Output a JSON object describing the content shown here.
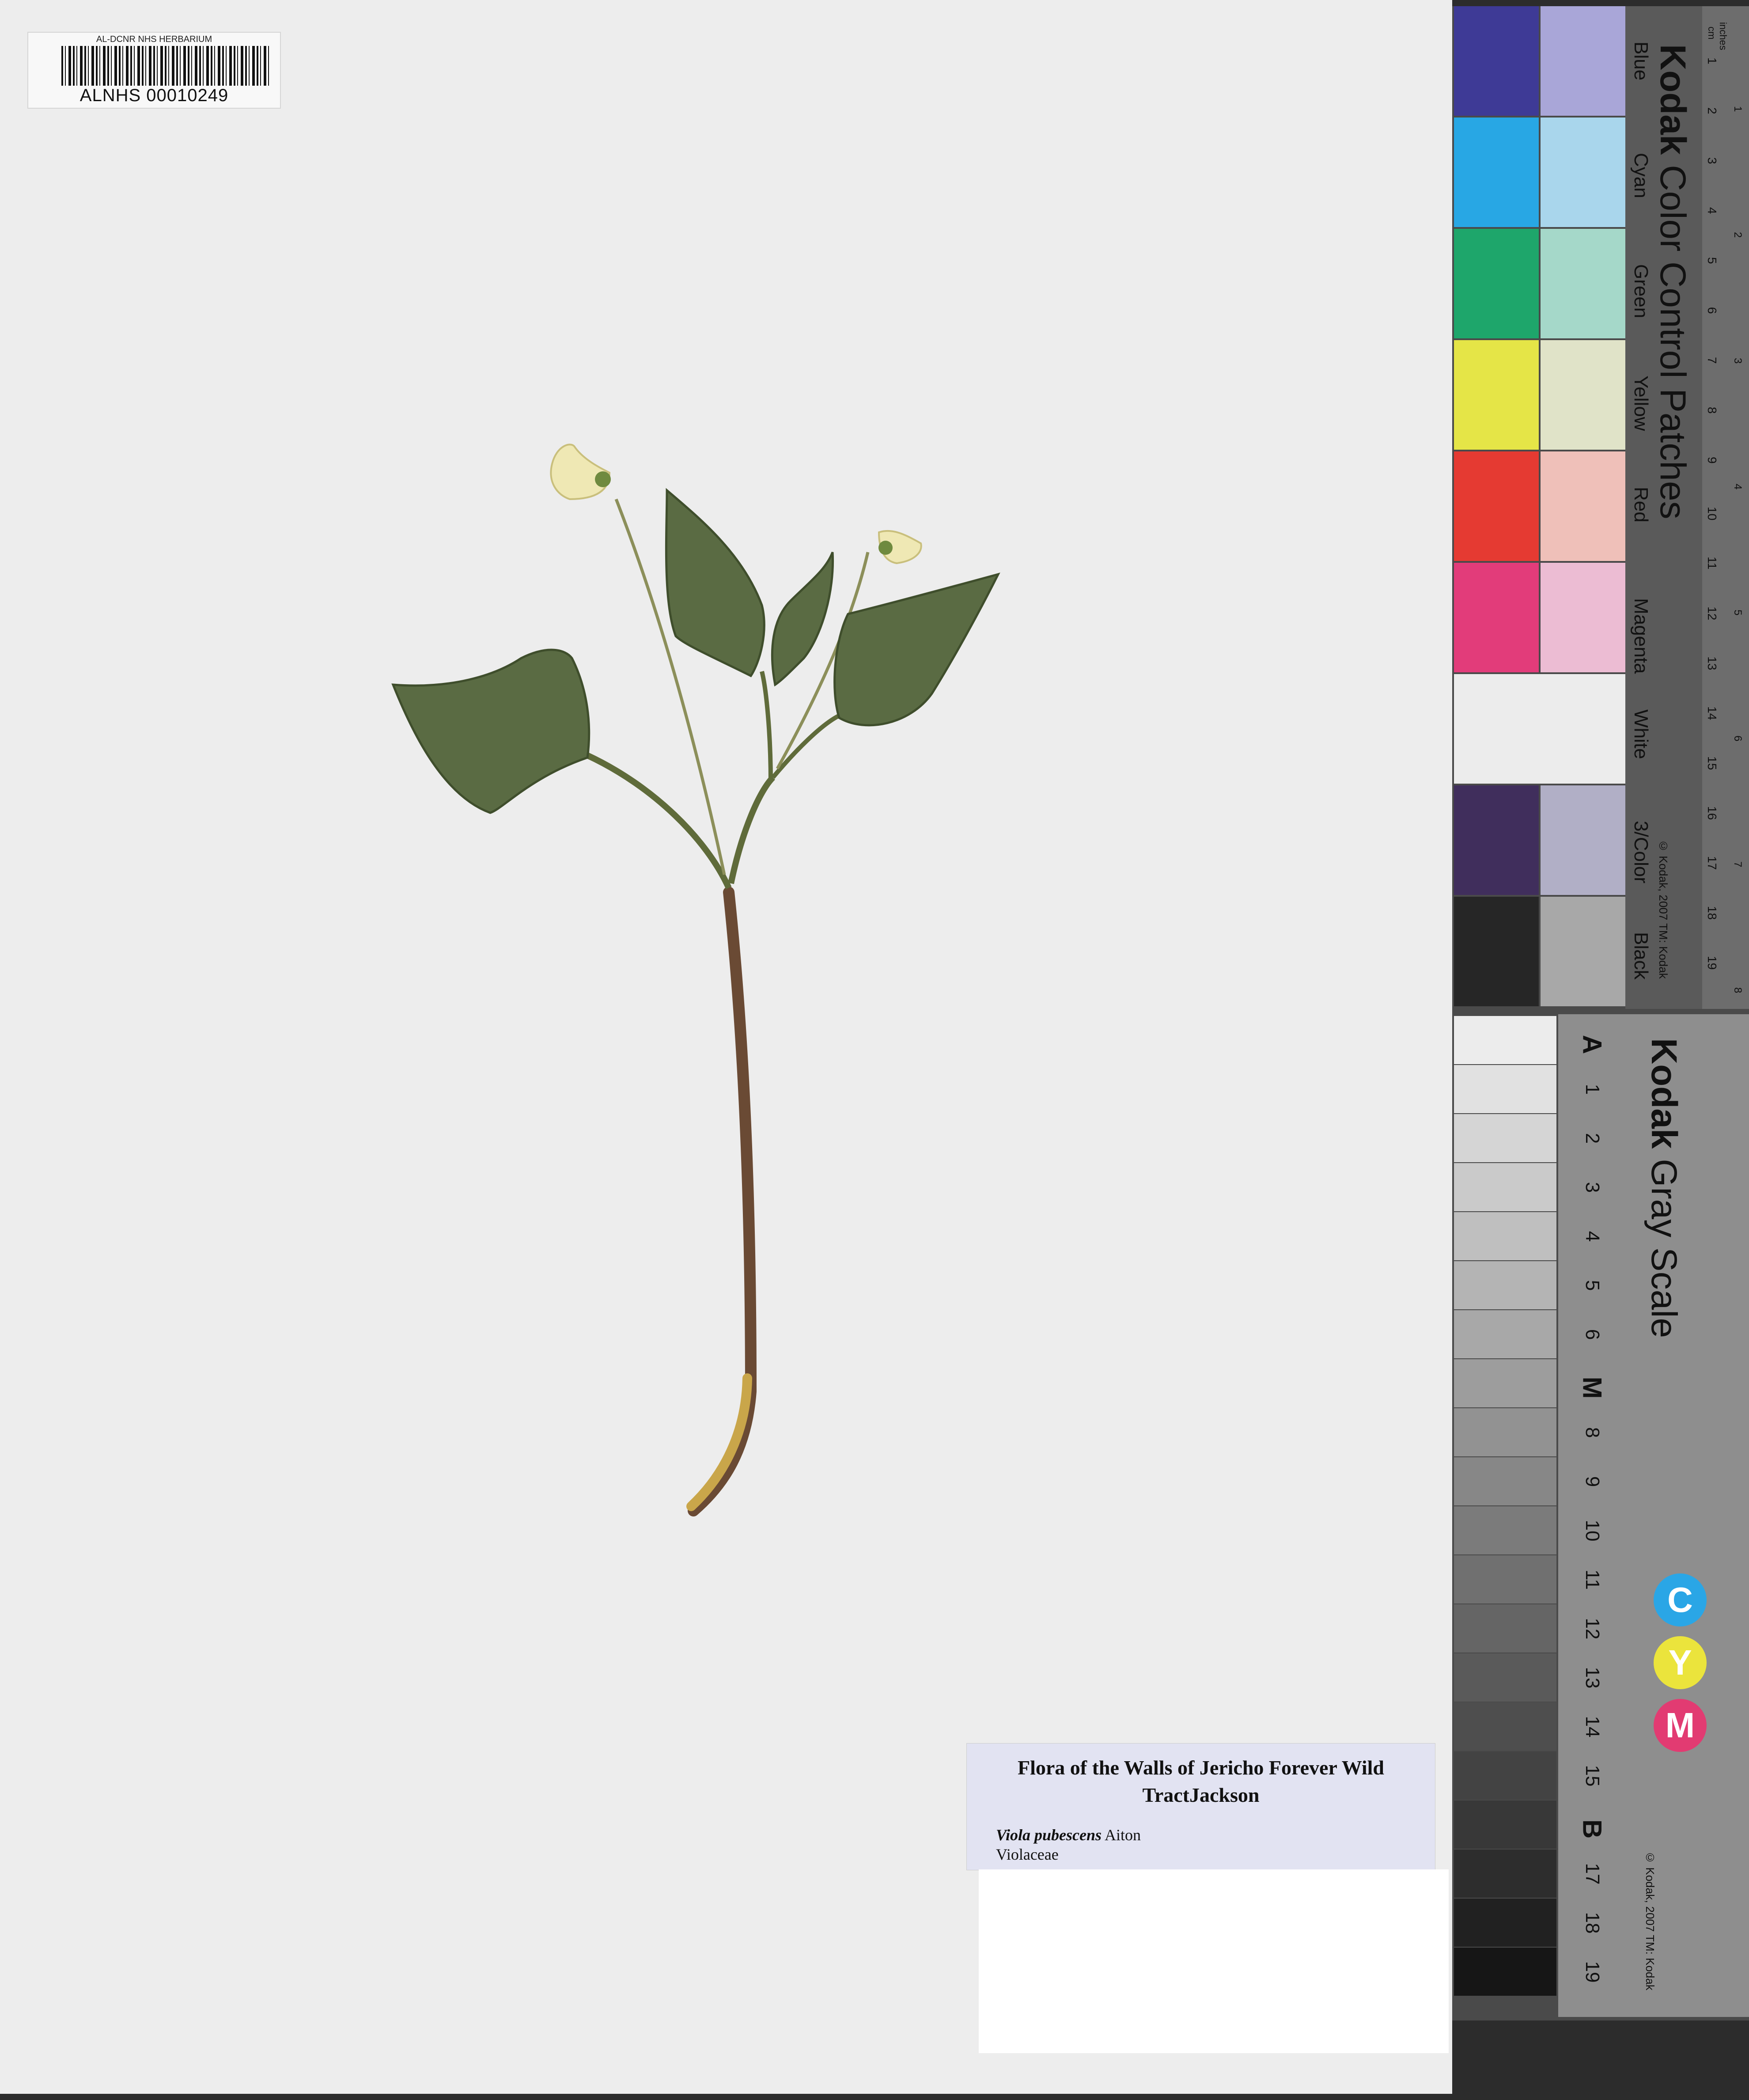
{
  "herbarium": {
    "institution_line": "AL-DCNR NHS HERBARIUM",
    "barcode_number": "ALNHS 00010249"
  },
  "label": {
    "title": "Flora of the Walls of Jericho Forever Wild TractJackson",
    "scientific_name": "Viola pubescens",
    "authority": "Aiton",
    "family": "Violaceae"
  },
  "color_card": {
    "brand": "Kodak",
    "product": "Color Control Patches",
    "patch_names": [
      "Blue",
      "Cyan",
      "Green",
      "Yellow",
      "Red",
      "Magenta",
      "White",
      "3/Color",
      "Black"
    ],
    "patch_colors": [
      [
        "#3e3a96",
        "#a9a6d8"
      ],
      [
        "#28a7e4",
        "#a9d6ec"
      ],
      [
        "#1ea66b",
        "#a5d8c9"
      ],
      [
        "#e5e547",
        "#e0e3c8"
      ],
      [
        "#e53a32",
        "#efc0b9"
      ],
      [
        "#e23c7a",
        "#ecbcd3"
      ],
      [
        "#ececec",
        "#ececec"
      ],
      [
        "#402e5c",
        "#b1afc6"
      ],
      [
        "#262626",
        "#a8a8a8"
      ]
    ],
    "copyright": "© Kodak, 2007 TM: Kodak",
    "ruler_units": [
      "inches",
      "cm"
    ],
    "cm_ticks": [
      "1",
      "2",
      "3",
      "4",
      "5",
      "6",
      "7",
      "8",
      "9",
      "10",
      "11",
      "12",
      "13",
      "14",
      "15",
      "16",
      "17",
      "18",
      "19"
    ],
    "inch_ticks": [
      "1",
      "2",
      "3",
      "4",
      "5",
      "6",
      "7",
      "8"
    ]
  },
  "gray_scale": {
    "brand": "Kodak",
    "product": "Gray Scale",
    "steps": [
      "A",
      "1",
      "2",
      "3",
      "4",
      "5",
      "6",
      "M",
      "8",
      "9",
      "10",
      "11",
      "12",
      "13",
      "14",
      "15",
      "B",
      "17",
      "18",
      "19"
    ],
    "copyright": "© Kodak, 2007 TM: Kodak",
    "cym": [
      "C",
      "Y",
      "M"
    ],
    "cym_colors": [
      "#2aa6e6",
      "#ebe43c",
      "#e23b72"
    ]
  }
}
